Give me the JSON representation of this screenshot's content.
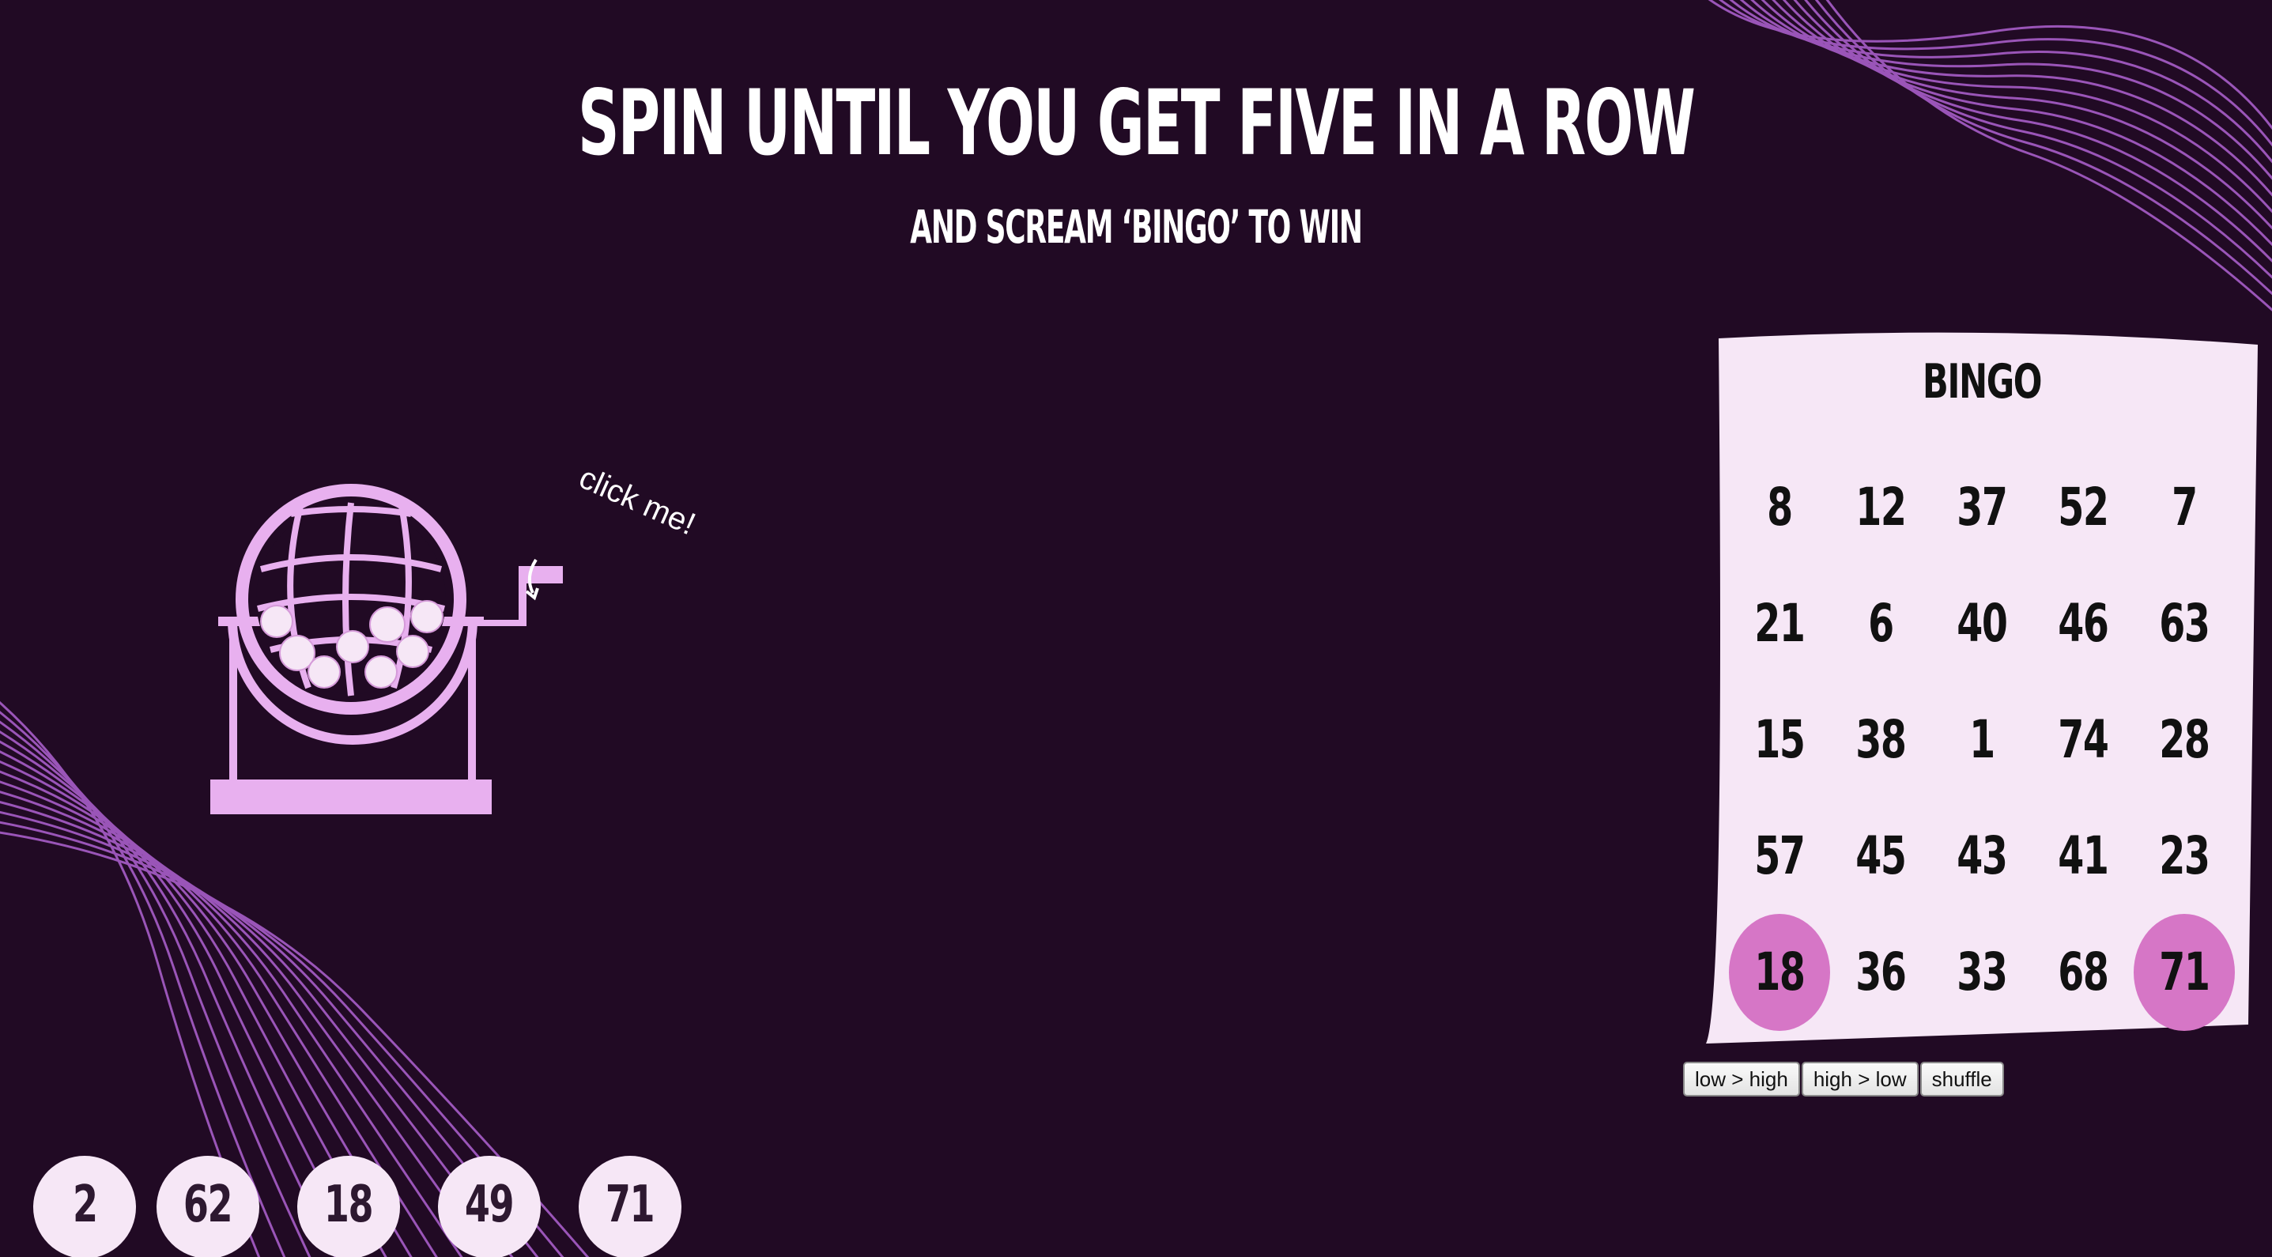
{
  "header": {
    "title": "SPIN UNTIL YOU GET FIVE IN A ROW",
    "subtitle": "AND SCREAM ‘BINGO’ TO WIN"
  },
  "machine": {
    "hint": "click me!",
    "icon": "bingo-cage-icon"
  },
  "card": {
    "title": "BINGO",
    "rows": [
      [
        8,
        12,
        37,
        52,
        7
      ],
      [
        21,
        6,
        40,
        46,
        63
      ],
      [
        15,
        38,
        1,
        74,
        28
      ],
      [
        57,
        45,
        43,
        41,
        23
      ],
      [
        18,
        36,
        33,
        68,
        71
      ]
    ],
    "marked": [
      18,
      71
    ]
  },
  "sort_buttons": {
    "low_high": "low > high",
    "high_low": "high > low",
    "shuffle": "shuffle"
  },
  "drawn_balls": [
    2,
    62,
    18,
    49,
    71
  ],
  "colors": {
    "background": "#210a24",
    "wave": "#9a55b8",
    "machine": "#e8b0ef",
    "card": "#f6e7f6",
    "marked": "#d676c6"
  }
}
